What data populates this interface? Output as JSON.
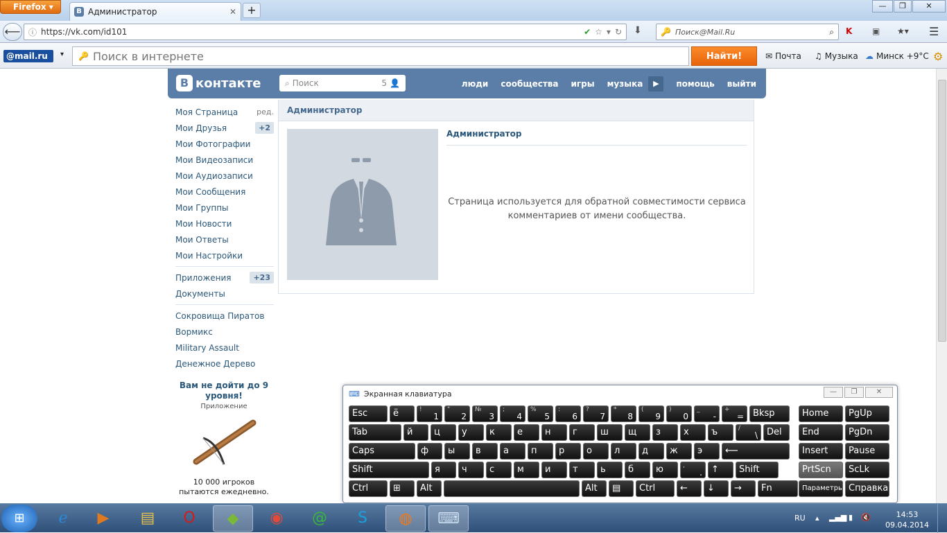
{
  "browser": {
    "app_button": "Firefox",
    "tab_title": "Администратор",
    "new_tab": "+",
    "url": "https://vk.com/id101",
    "search_placeholder": "Поиск@Mail.Ru"
  },
  "mailbar": {
    "logo": "@mail.ru",
    "search_placeholder": "Поиск в интернете",
    "find_button": "Найти!",
    "mail_link": "Почта",
    "music_link": "Музыка",
    "weather": "Минск +9°C"
  },
  "vk_header": {
    "logo": "контакте",
    "logo_letter": "В",
    "search_placeholder": "Поиск",
    "search_count": "5",
    "nav": [
      "люди",
      "сообщества",
      "игры",
      "музыка",
      "помощь",
      "выйти"
    ]
  },
  "left_menu": {
    "main": [
      {
        "label": "Моя Страница",
        "extra": "ред."
      },
      {
        "label": "Мои Друзья",
        "badge": "+2"
      },
      {
        "label": "Мои Фотографии"
      },
      {
        "label": "Мои Видеозаписи"
      },
      {
        "label": "Мои Аудиозаписи"
      },
      {
        "label": "Мои Сообщения"
      },
      {
        "label": "Мои Группы"
      },
      {
        "label": "Мои Новости"
      },
      {
        "label": "Мои Ответы"
      },
      {
        "label": "Мои Настройки"
      }
    ],
    "apps": [
      {
        "label": "Приложения",
        "badge": "+23"
      },
      {
        "label": "Документы"
      }
    ],
    "games": [
      "Сокровища Пиратов",
      "Вормикс",
      "Military Assault",
      "Денежное Дерево"
    ]
  },
  "ad": {
    "title": "Вам не дойти до 9 уровня!",
    "subtitle": "Приложение",
    "body": "10 000 игроков пытаются ежедневно."
  },
  "profile": {
    "header": "Администратор",
    "name": "Администратор",
    "description": "Страница используется для обратной совместимости сервиса комментариев от имени сообщества."
  },
  "osk": {
    "title": "Экранная клавиатура",
    "rows": [
      [
        [
          "Esc",
          "",
          ""
        ],
        [
          "ё",
          "",
          ""
        ],
        [
          "1",
          "!",
          ""
        ],
        [
          "2",
          "\"",
          ""
        ],
        [
          "3",
          "№",
          ""
        ],
        [
          "4",
          ";",
          ""
        ],
        [
          "5",
          "%",
          ""
        ],
        [
          "6",
          ":",
          ""
        ],
        [
          "7",
          "?",
          ""
        ],
        [
          "8",
          "*",
          ""
        ],
        [
          "9",
          "(",
          ""
        ],
        [
          "0",
          ")",
          ""
        ],
        [
          "-",
          "_",
          ""
        ],
        [
          "=",
          "+",
          ""
        ],
        [
          "Bksp",
          "",
          ""
        ]
      ],
      [
        [
          "Tab",
          "",
          ""
        ],
        [
          "й",
          "",
          ""
        ],
        [
          "ц",
          "",
          ""
        ],
        [
          "у",
          "",
          ""
        ],
        [
          "к",
          "",
          ""
        ],
        [
          "е",
          "",
          ""
        ],
        [
          "н",
          "",
          ""
        ],
        [
          "г",
          "",
          ""
        ],
        [
          "ш",
          "",
          ""
        ],
        [
          "щ",
          "",
          ""
        ],
        [
          "з",
          "",
          ""
        ],
        [
          "х",
          "",
          ""
        ],
        [
          "ъ",
          "",
          ""
        ],
        [
          "\\",
          "/",
          ""
        ],
        [
          "Del",
          "",
          ""
        ]
      ],
      [
        [
          "Caps",
          "",
          ""
        ],
        [
          "ф",
          "",
          ""
        ],
        [
          "ы",
          "",
          ""
        ],
        [
          "в",
          "",
          ""
        ],
        [
          "а",
          "",
          ""
        ],
        [
          "п",
          "",
          ""
        ],
        [
          "р",
          "",
          ""
        ],
        [
          "о",
          "",
          ""
        ],
        [
          "л",
          "",
          ""
        ],
        [
          "д",
          "",
          ""
        ],
        [
          "ж",
          "",
          ""
        ],
        [
          "э",
          "",
          ""
        ],
        [
          "⟵",
          "",
          ""
        ]
      ],
      [
        [
          "Shift",
          "",
          ""
        ],
        [
          "я",
          "",
          ""
        ],
        [
          "ч",
          "",
          ""
        ],
        [
          "с",
          "",
          ""
        ],
        [
          "м",
          "",
          ""
        ],
        [
          "и",
          "",
          ""
        ],
        [
          "т",
          "",
          ""
        ],
        [
          "ь",
          "",
          ""
        ],
        [
          "б",
          "",
          ""
        ],
        [
          "ю",
          "",
          ""
        ],
        [
          ".",
          ",",
          ""
        ],
        [
          "↑",
          "",
          ""
        ],
        [
          "Shift",
          "",
          ""
        ]
      ],
      [
        [
          "Ctrl",
          "",
          ""
        ],
        [
          "⊞",
          "",
          ""
        ],
        [
          "Alt",
          "",
          ""
        ],
        [
          "",
          "",
          ""
        ],
        [
          "Alt",
          "",
          ""
        ],
        [
          "▤",
          "",
          ""
        ],
        [
          "Ctrl",
          "",
          ""
        ],
        [
          "←",
          "",
          ""
        ],
        [
          "↓",
          "",
          ""
        ],
        [
          "→",
          "",
          ""
        ],
        [
          "Fn",
          "",
          ""
        ]
      ]
    ],
    "side": [
      [
        "Home",
        "PgUp"
      ],
      [
        "End",
        "PgDn"
      ],
      [
        "Insert",
        "Pause"
      ],
      [
        "PrtScn",
        "ScLk"
      ],
      [
        "Параметры",
        "Справка"
      ]
    ]
  },
  "tray": {
    "lang": "RU",
    "time": "14:53",
    "date": "09.04.2014"
  }
}
